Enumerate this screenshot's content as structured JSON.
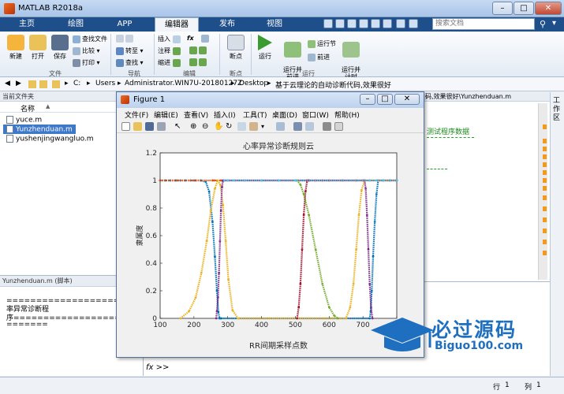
{
  "window": {
    "title": "MATLAB R2018a"
  },
  "ribbon_tabs": [
    "主页",
    "绘图",
    "APP",
    "编辑器",
    "发布",
    "视图"
  ],
  "search": {
    "placeholder": "搜索文档"
  },
  "ribbon": {
    "file": {
      "new": "新建",
      "open": "打开",
      "save": "保存",
      "find_files": "查找文件",
      "compare": "比较",
      "print": "打印",
      "group": "文件"
    },
    "navigate": {
      "goto": "转至",
      "find": "查找",
      "group": "导航"
    },
    "edit": {
      "insert": "插入",
      "comment": "注释",
      "indent": "缩进",
      "fx": "fx",
      "group": "编辑"
    },
    "breakpoints": {
      "label": "断点",
      "group": "断点"
    },
    "run": {
      "run": "运行",
      "run_advance": "运行并\n前进",
      "run_section": "运行节",
      "advance": "前进",
      "run_time": "运行并\n计时",
      "group": "运行"
    }
  },
  "path": {
    "crumbs": [
      "C:",
      "Users",
      "Administrator.WIN7U-20180127Z",
      "Desktop",
      "基于云理论的自动诊断代码,效果很好"
    ]
  },
  "current_folder": {
    "header": "当前文件夹",
    "col_name": "名称",
    "col_sort": "▲",
    "files": [
      "yuce.m",
      "Yunzhenduan.m",
      "yushenjingwangluo.m"
    ],
    "selected_index": 1
  },
  "details": {
    "header": "Yunzhenduan.m  (脚本)",
    "lines": [
      "===================基于云",
      "率异常诊断程",
      "序=======================",
      "======="
    ]
  },
  "editor": {
    "tab": "码,效果很好\\Yunzhenduan.m",
    "side_label": "工作区",
    "snippet": "测试程序数据"
  },
  "command": {
    "prompt": "fx >>"
  },
  "status": {
    "row_label": "行",
    "row": "1",
    "col_label": "列",
    "col": "1"
  },
  "figure": {
    "title": "Figure 1",
    "menus": [
      "文件(F)",
      "编辑(E)",
      "查看(V)",
      "插入(I)",
      "工具(T)",
      "桌面(D)",
      "窗口(W)",
      "帮助(H)"
    ]
  },
  "watermark": {
    "text": "必过源码",
    "url": "Biguo100.com"
  },
  "chart_data": {
    "type": "scatter",
    "title": "心率异常诊断规则云",
    "xlabel": "RR间期采样点数",
    "ylabel": "隶属度",
    "xlim": [
      100,
      800
    ],
    "ylim": [
      0,
      1.2
    ],
    "xticks": [
      100,
      200,
      300,
      400,
      500,
      600,
      700,
      800
    ],
    "yticks": [
      0,
      0.2,
      0.4,
      0.6,
      0.8,
      1,
      1.2
    ],
    "grid": false,
    "series": [
      {
        "color": "#0072bd",
        "x": [
          100,
          115,
          130,
          145,
          160,
          175,
          190,
          205,
          220,
          235,
          245,
          255,
          262,
          268,
          272,
          276,
          280,
          720,
          723,
          726,
          730,
          735,
          740,
          745,
          760,
          780,
          800
        ],
        "y": [
          1,
          1,
          1,
          1,
          1,
          1,
          1,
          1,
          1,
          0.99,
          0.92,
          0.7,
          0.45,
          0.2,
          0.05,
          0,
          0,
          0,
          0.05,
          0.2,
          0.45,
          0.7,
          0.9,
          1,
          1,
          1,
          1
        ]
      },
      {
        "color": "#d95319",
        "x": [
          100,
          150,
          200,
          255,
          260,
          280,
          300,
          350,
          400,
          450,
          500,
          540,
          560,
          580,
          600,
          640,
          680,
          700,
          720,
          760,
          800
        ],
        "y": [
          1,
          1,
          1,
          1,
          1,
          1,
          1,
          1,
          1,
          1,
          1,
          1,
          1,
          1,
          1,
          1,
          1,
          1,
          1,
          1,
          1
        ]
      },
      {
        "color": "#edb120",
        "x": [
          160,
          185,
          205,
          222,
          238,
          250,
          262,
          270,
          278,
          286,
          294,
          302,
          314,
          330,
          650,
          662,
          672,
          680,
          688,
          696,
          705
        ],
        "y": [
          0,
          0.05,
          0.15,
          0.33,
          0.56,
          0.78,
          0.94,
          1,
          0.97,
          0.82,
          0.56,
          0.28,
          0.06,
          0,
          0,
          0.08,
          0.25,
          0.5,
          0.75,
          0.93,
          1
        ]
      },
      {
        "color": "#7e2f8e",
        "x": [
          266,
          268,
          271,
          274,
          277,
          280,
          283,
          286,
          289,
          705,
          708,
          712,
          716,
          720,
          724,
          728
        ],
        "y": [
          0,
          0.05,
          0.15,
          0.33,
          0.56,
          0.78,
          0.95,
          1,
          1,
          1,
          0.94,
          0.75,
          0.5,
          0.25,
          0.08,
          0
        ]
      },
      {
        "color": "#a2142f",
        "x": [
          505,
          510,
          515,
          520,
          525,
          530,
          535,
          540
        ],
        "y": [
          0,
          0.08,
          0.25,
          0.5,
          0.75,
          0.92,
          1,
          1
        ]
      },
      {
        "color": "#77ac30",
        "x": [
          505,
          515,
          525,
          540,
          560,
          580,
          600,
          615,
          625
        ],
        "y": [
          1,
          0.97,
          0.9,
          0.75,
          0.5,
          0.25,
          0.08,
          0.02,
          0
        ]
      },
      {
        "color": "#4dbeee",
        "x": [
          290,
          300,
          320,
          350,
          400,
          450,
          500,
          720,
          740,
          760,
          800
        ],
        "y": [
          1,
          1,
          1,
          1,
          1,
          1,
          1,
          1,
          1,
          1,
          1
        ]
      }
    ]
  }
}
